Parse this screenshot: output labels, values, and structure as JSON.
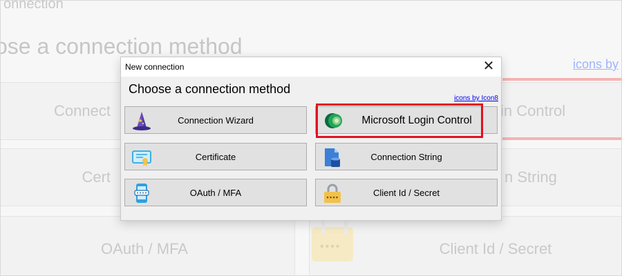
{
  "background": {
    "title": "onnection",
    "heading": "ose a connection method",
    "link": "icons by",
    "buttons": [
      "Connect",
      "in Control",
      "Cert",
      "n String",
      "OAuth / MFA",
      "Client Id / Secret"
    ]
  },
  "dialog": {
    "title": "New connection",
    "close_label": "✕",
    "heading": "Choose a connection method",
    "icons_link": "icons by Icon8",
    "buttons": {
      "wizard": "Connection Wizard",
      "microsoft": "Microsoft Login Control",
      "certificate": "Certificate",
      "connection_string": "Connection String",
      "oauth": "OAuth / MFA",
      "client_secret": "Client Id / Secret"
    }
  },
  "colors": {
    "highlight": "#e1111f",
    "button_bg": "#e1e1e1",
    "dialog_bg": "#f0f0f0"
  }
}
